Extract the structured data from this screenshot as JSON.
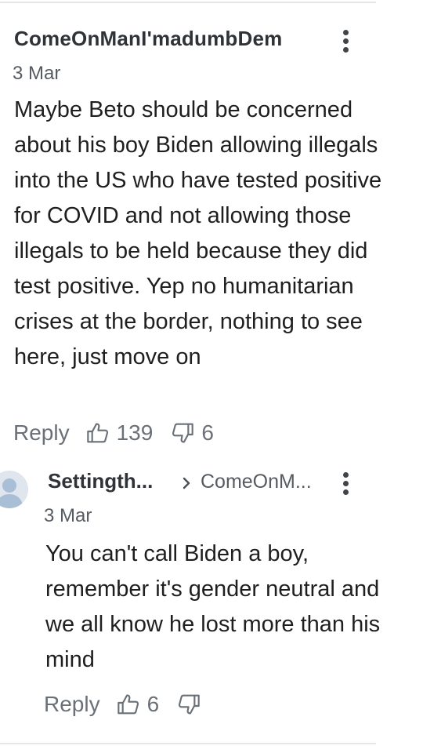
{
  "comment": {
    "author": "ComeOnManI'madumbDem",
    "date": "3 Mar",
    "text": "Maybe Beto should be concerned about his boy Biden allowing illegals into the US who have tested positive for COVID and not allowing those illegals to be held because they did test positive. Yep no humanitarian crises at the border, nothing to see here, just move on",
    "reply_label": "Reply",
    "likes": "139",
    "dislikes": "6"
  },
  "reply": {
    "author": "Settingth...",
    "reply_to": "ComeOnM...",
    "date": "3 Mar",
    "text": "You can't call Biden a boy, remember it's gender neutral and we all know he lost more than his mind",
    "reply_label": "Reply",
    "likes": "6"
  },
  "icons": {
    "more": "kebab-menu-icon",
    "like": "thumbs-up-icon",
    "dislike": "thumbs-down-icon",
    "reply_arrow": "chevron-right-icon",
    "avatar": "user-avatar-icon"
  }
}
